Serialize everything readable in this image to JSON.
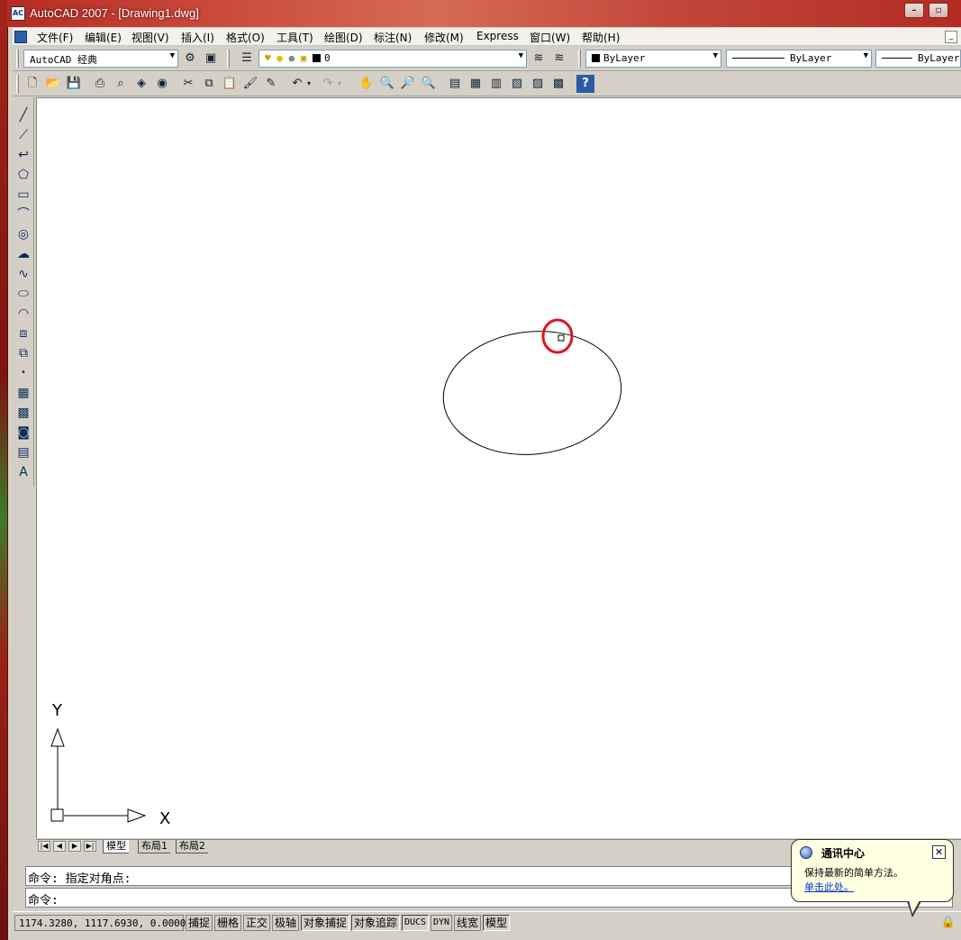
{
  "window": {
    "title": "AutoCAD 2007 - [Drawing1.dwg]",
    "app_icon_text": "AC",
    "minimize_label": "–",
    "restore_label": "▫"
  },
  "menubar": {
    "items": [
      "文件(F)",
      "编辑(E)",
      "视图(V)",
      "插入(I)",
      "格式(O)",
      "工具(T)",
      "绘图(D)",
      "标注(N)",
      "修改(M)",
      "Express",
      "窗口(W)",
      "帮助(H)"
    ],
    "mdi_minimize_label": "_"
  },
  "toolbar": {
    "workspace": "AutoCAD 经典",
    "layer": "0",
    "color": "ByLayer",
    "linetype": "ByLayer",
    "lineweight": "ByLayer"
  },
  "layout_tabs": {
    "nav": [
      "|◀",
      "◀",
      "▶",
      "▶|"
    ],
    "tabs": [
      "模型",
      "布局1",
      "布局2"
    ],
    "active": "模型"
  },
  "ucs": {
    "x_label": "X",
    "y_label": "Y"
  },
  "command": {
    "line1": "命令: 指定对角点:",
    "line2": "命令:"
  },
  "status": {
    "coordinates": "1174.3280, 1117.6930, 0.0000",
    "toggles": [
      "捕捉",
      "栅格",
      "正交",
      "极轴",
      "对象捕捉",
      "对象追踪",
      "DUCS",
      "DYN",
      "线宽",
      "模型"
    ]
  },
  "balloon": {
    "title": "通讯中心",
    "body": "保持最新的简单方法。",
    "link": "单击此处。",
    "close_label": "✕"
  },
  "colors": {
    "highlight_circle": "#e0141e",
    "titlebar": "#b52b22",
    "balloon_bg": "#ffffe1"
  }
}
